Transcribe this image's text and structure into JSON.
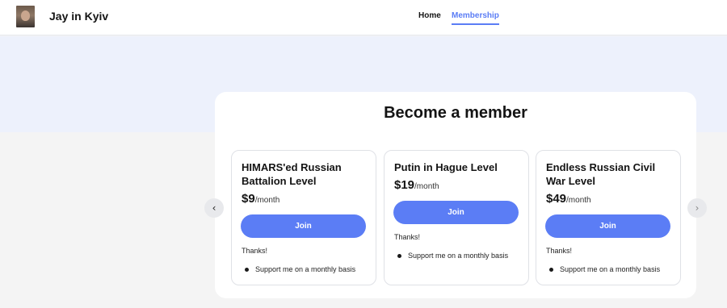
{
  "header": {
    "site_title": "Jay in Kyiv",
    "nav": {
      "home": "Home",
      "membership": "Membership"
    }
  },
  "colors": {
    "accent": "#5b7df5",
    "hero_band": "#edf1fc",
    "page_bg": "#f4f4f4"
  },
  "main": {
    "title": "Become a member",
    "price_suffix": "/month",
    "tiers": [
      {
        "name": "HIMARS'ed Russian Battalion Level",
        "price": "$9",
        "join_label": "Join",
        "thanks": "Thanks!",
        "benefit": "Support me on a monthly basis"
      },
      {
        "name": "Putin in Hague Level",
        "price": "$19",
        "join_label": "Join",
        "thanks": "Thanks!",
        "benefit": "Support me on a monthly basis"
      },
      {
        "name": "Endless Russian Civil War Level",
        "price": "$49",
        "join_label": "Join",
        "thanks": "Thanks!",
        "benefit": "Support me on a monthly basis"
      }
    ],
    "carousel": {
      "prev_icon": "chevron-left-icon",
      "next_icon": "chevron-right-icon"
    }
  }
}
